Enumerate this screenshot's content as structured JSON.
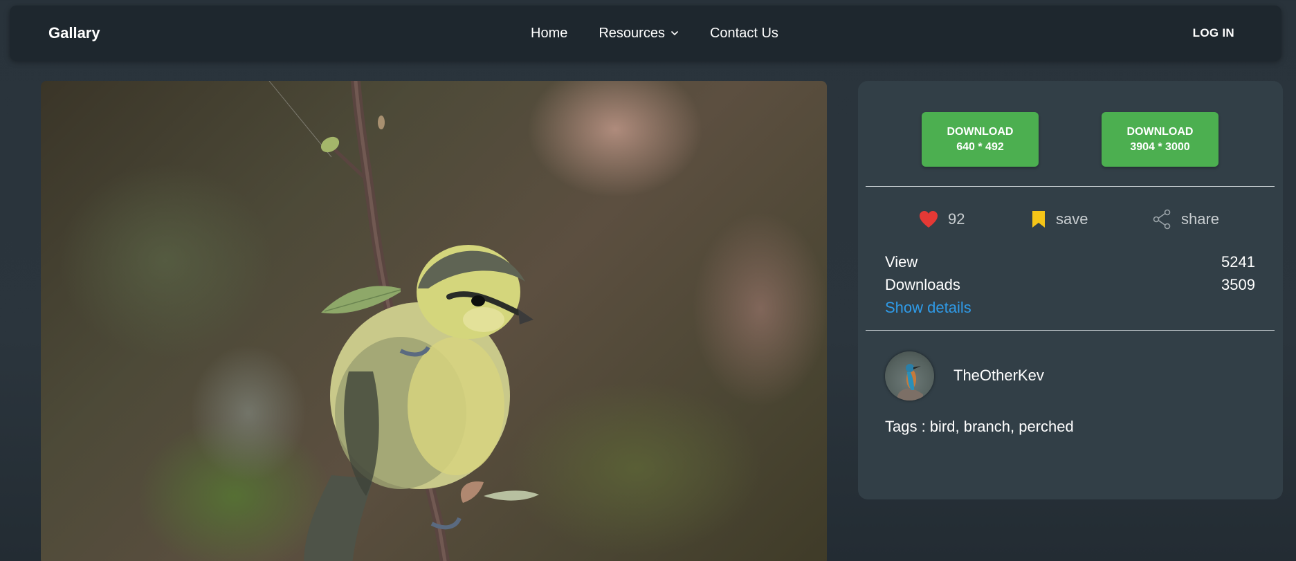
{
  "nav": {
    "brand": "Gallary",
    "links": [
      {
        "label": "Home"
      },
      {
        "label": "Resources"
      },
      {
        "label": "Contact Us"
      }
    ],
    "login_label": "LOG IN"
  },
  "downloads": [
    {
      "label": "DOWNLOAD",
      "size": "640 * 492"
    },
    {
      "label": "DOWNLOAD",
      "size": "3904 * 3000"
    }
  ],
  "actions": {
    "likes": "92",
    "save_label": "save",
    "share_label": "share"
  },
  "stats": {
    "view_label": "View",
    "view_value": "5241",
    "downloads_label": "Downloads",
    "downloads_value": "3509",
    "show_details": "Show details"
  },
  "author": {
    "name": "TheOtherKev"
  },
  "tags_text": "Tags : bird, branch, perched",
  "icons": {
    "like": "heart-icon",
    "save": "bookmark-icon",
    "share": "share-icon",
    "resources_dropdown": "chevron-down-icon"
  },
  "colors": {
    "download_button": "#4caf50",
    "link": "#2f9be8",
    "heart": "#e53935",
    "bookmark": "#f5c518"
  }
}
